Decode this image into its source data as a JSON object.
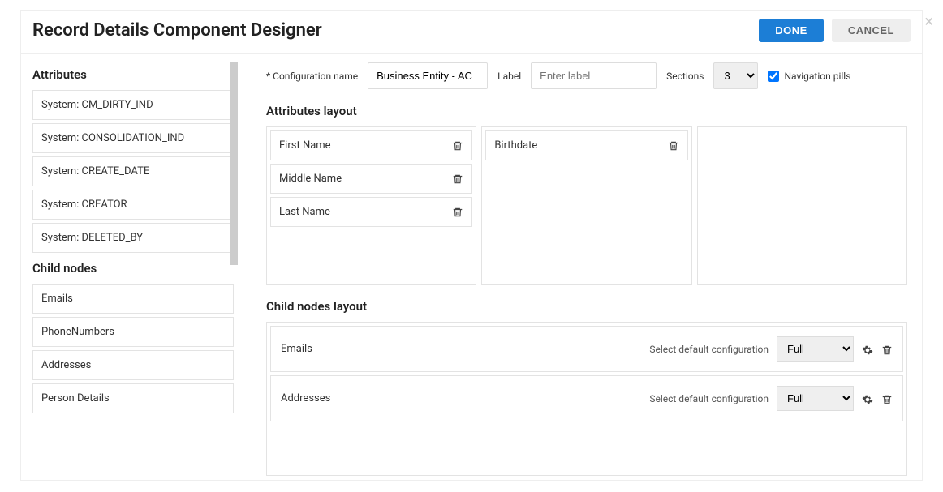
{
  "dialog": {
    "title": "Record Details Component Designer",
    "done": "DONE",
    "cancel": "CANCEL"
  },
  "config": {
    "name_label": "Configuration name",
    "name_value": "Business Entity - AC",
    "label_label": "Label",
    "label_placeholder": "Enter label",
    "label_value": "",
    "sections_label": "Sections",
    "sections_value": "3",
    "nav_pills_label": "Navigation pills",
    "nav_pills_checked": true
  },
  "left": {
    "attributes_heading": "Attributes",
    "attributes": [
      "System: CM_DIRTY_IND",
      "System: CONSOLIDATION_IND",
      "System: CREATE_DATE",
      "System: CREATOR",
      "System: DELETED_BY"
    ],
    "child_heading": "Child nodes",
    "child_nodes": [
      "Emails",
      "PhoneNumbers",
      "Addresses",
      "Person Details"
    ]
  },
  "layout": {
    "attributes_heading": "Attributes layout",
    "columns": [
      [
        "First Name",
        "Middle Name",
        "Last Name"
      ],
      [
        "Birthdate"
      ],
      []
    ],
    "child_heading": "Child nodes layout",
    "child_select_label": "Select default configuration",
    "child_rows": [
      {
        "name": "Emails",
        "config": "Full"
      },
      {
        "name": "Addresses",
        "config": "Full"
      }
    ]
  }
}
